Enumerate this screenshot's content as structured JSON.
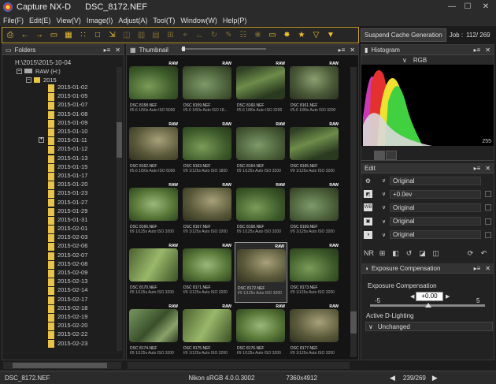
{
  "window": {
    "app_title": "Capture NX-D",
    "doc_title": "DSC_8172.NEF",
    "min": "—",
    "max": "☐",
    "close": "✕"
  },
  "menu": [
    "File(F)",
    "Edit(E)",
    "View(V)",
    "Image(I)",
    "Adjust(A)",
    "Tool(T)",
    "Window(W)",
    "Help(P)"
  ],
  "toolbar": {
    "icons": [
      {
        "name": "print-icon",
        "glyph": "⎙"
      },
      {
        "name": "back-arrow-icon",
        "glyph": "←"
      },
      {
        "name": "forward-arrow-icon",
        "glyph": "→"
      },
      {
        "name": "open-folder-icon",
        "glyph": "▭"
      },
      {
        "name": "grid-large-icon",
        "glyph": "▦"
      },
      {
        "name": "grid-small-icon",
        "glyph": "∷"
      },
      {
        "name": "single-view-icon",
        "glyph": "□"
      },
      {
        "name": "fullscreen-icon",
        "glyph": "⇲"
      },
      {
        "name": "compare-two-icon",
        "glyph": "◫"
      },
      {
        "name": "compare-side-icon",
        "glyph": "▥"
      },
      {
        "name": "filmstrip-icon",
        "glyph": "▤"
      },
      {
        "name": "grid-compare-icon",
        "glyph": "⊞"
      },
      {
        "name": "crop-icon",
        "glyph": "⌖"
      },
      {
        "name": "straighten-icon",
        "glyph": "⌳"
      },
      {
        "name": "rotate-icon",
        "glyph": "↻"
      },
      {
        "name": "pen-icon",
        "glyph": "✎"
      },
      {
        "name": "speech-icon",
        "glyph": "☷"
      },
      {
        "name": "color-icon",
        "glyph": "❀"
      },
      {
        "name": "monitor-icon",
        "glyph": "▭"
      },
      {
        "name": "settings-icon",
        "glyph": "✸"
      },
      {
        "name": "star-icon",
        "glyph": "★"
      },
      {
        "name": "filter-icon",
        "glyph": "▽"
      },
      {
        "name": "filter-settings-icon",
        "glyph": "▼"
      }
    ],
    "suspend_label": "Suspend Cache Generation",
    "job_label": "Job :",
    "job_value": "112/  269"
  },
  "folders": {
    "title": "Folders",
    "path": "H:\\2015\\2015-10-04",
    "drive": "RAW (H:)",
    "year": "2015",
    "dates": [
      "2015-01-02",
      "2015-01-05",
      "2015-01-07",
      "2015-01-08",
      "2015-01-09",
      "2015-01-10",
      "2015-01-11",
      "2015-01-12",
      "2015-01-13",
      "2015-01-15",
      "2015-01-17",
      "2015-01-20",
      "2015-01-23",
      "2015-01-27",
      "2015-01-29",
      "2015-01-31",
      "2015-02-01",
      "2015-02-03",
      "2015-02-06",
      "2015-02-07",
      "2015-02-08",
      "2015-02-09",
      "2015-02-13",
      "2015-02-14",
      "2015-02-17",
      "2015-02-18",
      "2015-02-19",
      "2015-02-20",
      "2015-02-22",
      "2015-02-23"
    ]
  },
  "thumbnail": {
    "title": "Thumbnail",
    "raw_badge": "RAW",
    "items": [
      {
        "name": "DSC 8158.NEF",
        "meta": "f/5.6 1/50s Auto ISO 5000"
      },
      {
        "name": "DSC 8159.NEF",
        "meta": "f/5.6 1/60s Auto ISO 18..."
      },
      {
        "name": "DSC 8160.NEF",
        "meta": "f/5.6 1/80s Auto ISO 3200"
      },
      {
        "name": "DSC 8161.NEF",
        "meta": "f/5.6 1/80s Auto ISO 3200"
      },
      {
        "name": "DSC 8162.NEF",
        "meta": "f/5.6 1/50s Auto ISO 5000"
      },
      {
        "name": "DSC 8163.NEF",
        "meta": "f/9 1/125s Auto ISO 1800"
      },
      {
        "name": "DSC 8164.NEF",
        "meta": "f/9 1/125s Auto ISO 3200"
      },
      {
        "name": "DSC 8165.NEF",
        "meta": "f/9 1/125s Auto ISO 3200"
      },
      {
        "name": "DSC 8166.NEF",
        "meta": "f/9 1/125s Auto ISO 3200"
      },
      {
        "name": "DSC 8167.NEF",
        "meta": "f/9 1/125s Auto ISO 3200"
      },
      {
        "name": "DSC 8168.NEF",
        "meta": "f/9 1/125s Auto ISO 3200"
      },
      {
        "name": "DSC 8169.NEF",
        "meta": "f/9 1/125s Auto ISO 3200"
      },
      {
        "name": "DSC 8170.NEF",
        "meta": "f/9 1/125s Auto ISO 3200"
      },
      {
        "name": "DSC 8171.NEF",
        "meta": "f/9 1/125s Auto ISO 3200"
      },
      {
        "name": "DSC 8172.NEF",
        "meta": "f/9 1/125s Auto ISO 3200"
      },
      {
        "name": "DSC 8173.NEF",
        "meta": "f/9 1/125s Auto ISO 3200"
      },
      {
        "name": "DSC 8174.NEF",
        "meta": "f/9 1/125s Auto ISO 3200"
      },
      {
        "name": "DSC 8175.NEF",
        "meta": "f/9 1/125s Auto ISO 3200"
      },
      {
        "name": "DSC 8176.NEF",
        "meta": "f/9 1/125s Auto ISO 3200"
      },
      {
        "name": "DSC 8177.NEF",
        "meta": "f/9 1/125s Auto ISO 3200"
      }
    ],
    "selected": "DSC 8172.NEF"
  },
  "histogram": {
    "title": "Histogram",
    "channel": "RGB",
    "min_label": "0",
    "max_label": "255"
  },
  "edit": {
    "title": "Edit",
    "rows": [
      {
        "icon": "gear-icon",
        "value": "Original"
      },
      {
        "icon": "exposure-icon",
        "value": "+0.0ev"
      },
      {
        "icon": "white-balance-icon",
        "value": "Original"
      },
      {
        "icon": "picture-control-icon",
        "value": "Original"
      },
      {
        "icon": "levels-icon",
        "value": "Original"
      }
    ],
    "tools": [
      "NR",
      "⊞",
      "◧",
      "↺",
      "◪",
      "◫"
    ]
  },
  "exposure": {
    "title": "Exposure Compensation",
    "label": "Exposure Compensation",
    "min": "-5",
    "max": "5",
    "value": "+0.00",
    "adl_label": "Active D-Lighting",
    "adl_value": "Unchanged"
  },
  "status": {
    "filename": "DSC_8172.NEF",
    "profile": "Nikon sRGB 4.0.0.3002",
    "dims": "7360x4912",
    "count": "239/269"
  }
}
